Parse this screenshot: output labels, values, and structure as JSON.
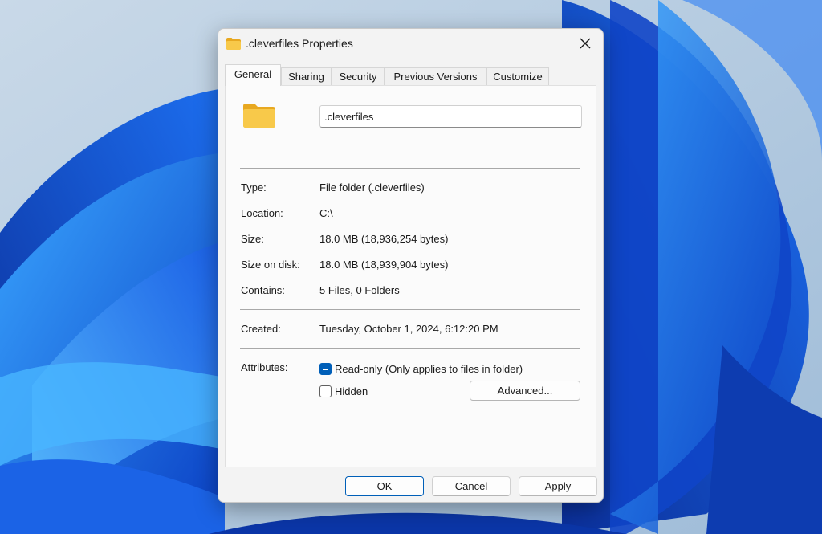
{
  "window": {
    "title": ".cleverfiles Properties"
  },
  "tabs": [
    {
      "label": "General",
      "active": true
    },
    {
      "label": "Sharing"
    },
    {
      "label": "Security"
    },
    {
      "label": "Previous Versions"
    },
    {
      "label": "Customize"
    }
  ],
  "general": {
    "name_value": ".cleverfiles",
    "type": {
      "label": "Type:",
      "value": "File folder (.cleverfiles)"
    },
    "location": {
      "label": "Location:",
      "value": "C:\\"
    },
    "size": {
      "label": "Size:",
      "value": "18.0 MB (18,936,254 bytes)"
    },
    "size_on_disk": {
      "label": "Size on disk:",
      "value": "18.0 MB (18,939,904 bytes)"
    },
    "contains": {
      "label": "Contains:",
      "value": "5 Files, 0 Folders"
    },
    "created": {
      "label": "Created:",
      "value": "Tuesday, October 1, 2024, 6:12:20 PM"
    },
    "attributes": {
      "label": "Attributes:",
      "readonly_label": "Read-only (Only applies to files in folder)",
      "readonly_state": "indeterminate",
      "hidden_label": "Hidden",
      "hidden_state": "unchecked",
      "advanced_label": "Advanced..."
    }
  },
  "footer": {
    "ok_label": "OK",
    "cancel_label": "Cancel",
    "apply_label": "Apply"
  },
  "icons": {
    "title": "folder-icon",
    "close": "close-icon",
    "big": "folder-icon"
  },
  "colors": {
    "accent": "#005fb8",
    "folder": "#f8c94a",
    "wallpaper_bg": "#a9c4dc",
    "wallpaper_blue": "#1565e0"
  }
}
